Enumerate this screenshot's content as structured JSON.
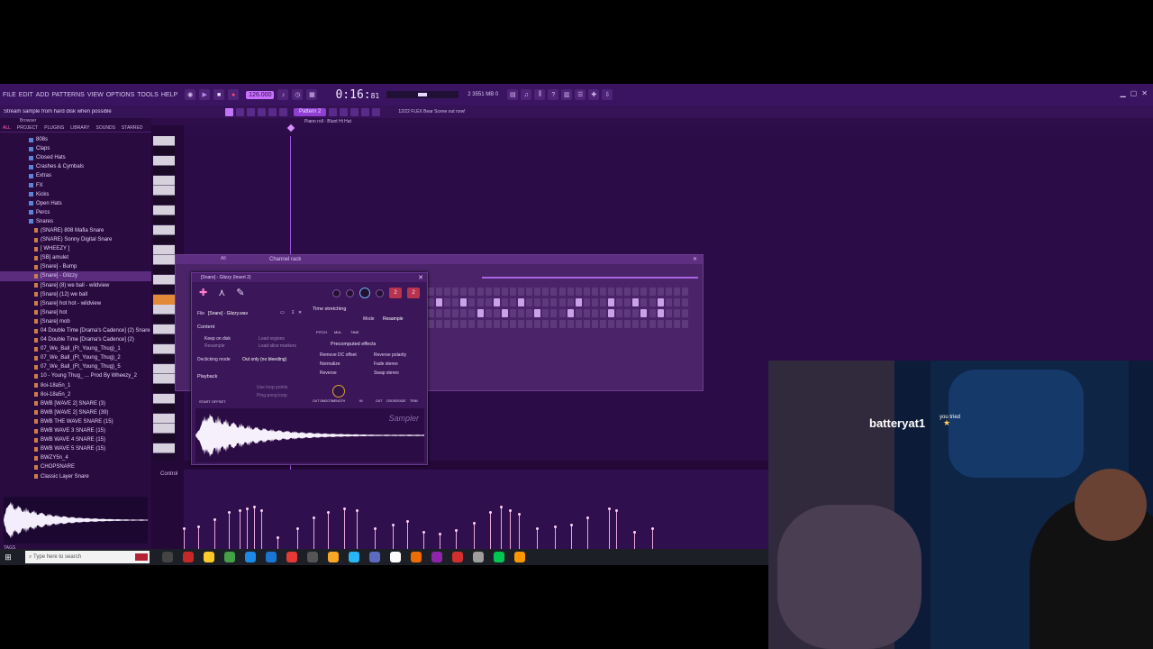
{
  "menu": {
    "items": [
      "FILE",
      "EDIT",
      "ADD",
      "PATTERNS",
      "VIEW",
      "OPTIONS",
      "TOOLS",
      "HELP"
    ],
    "tempo": "126.000",
    "time": "0:16:",
    "time_sub": "81",
    "cpu": "2  3551 MB\n  0"
  },
  "toolbar2": {
    "hint": "Stream sample from hard disk when possible",
    "pattern": "Pattern 2",
    "news": "12/22 FLEX Bear Scene\nout now!"
  },
  "browser": {
    "title": "Browser",
    "tabs": [
      "ALL",
      "PROJECT",
      "PLUGINS",
      "LIBRARY",
      "SOUNDS",
      "STARRED"
    ],
    "items": [
      {
        "label": "808s",
        "type": "folder"
      },
      {
        "label": "Claps",
        "type": "folder"
      },
      {
        "label": "Closed Hats",
        "type": "folder"
      },
      {
        "label": "Crashes & Cymbals",
        "type": "folder"
      },
      {
        "label": "Extras",
        "type": "folder"
      },
      {
        "label": "FX",
        "type": "folder"
      },
      {
        "label": "Kicks",
        "type": "folder"
      },
      {
        "label": "Open Hats",
        "type": "folder"
      },
      {
        "label": "Percs",
        "type": "folder"
      },
      {
        "label": "Snares",
        "type": "folder"
      },
      {
        "label": "(SNARE) 808 Mafia Snare",
        "type": "file"
      },
      {
        "label": "(SNARE) Sonny Digital Snare",
        "type": "file"
      },
      {
        "label": "[ WHEEZY ]",
        "type": "file"
      },
      {
        "label": "[SB] amulet",
        "type": "file"
      },
      {
        "label": "[Snare] - Bump",
        "type": "file"
      },
      {
        "label": "[Snare] - Glizzy",
        "type": "file",
        "selected": true
      },
      {
        "label": "[Snare] (8) we ball - wildview",
        "type": "file"
      },
      {
        "label": "[Snare] (12) we ball",
        "type": "file"
      },
      {
        "label": "[Snare] hot hot - wildview",
        "type": "file"
      },
      {
        "label": "[Snare] hot",
        "type": "file"
      },
      {
        "label": "[Snare] mob",
        "type": "file"
      },
      {
        "label": "04 Double Time [Drama's Cadence] (2) Snare",
        "type": "file"
      },
      {
        "label": "04 Double Time [Drama's Cadence] (2)",
        "type": "file"
      },
      {
        "label": "07_We_Ball_(Ft_Young_Thug)_1",
        "type": "file"
      },
      {
        "label": "07_We_Ball_(Ft_Young_Thug)_2",
        "type": "file"
      },
      {
        "label": "07_We_Ball_(Ft_Young_Thug)_5",
        "type": "file"
      },
      {
        "label": "10 - Young Thug_ ... Prod By Wheezy_2",
        "type": "file"
      },
      {
        "label": "8oi-18a5n_1",
        "type": "file"
      },
      {
        "label": "8oi-18a5n_2",
        "type": "file"
      },
      {
        "label": "BWB [WAVE 2] SNARE (3)",
        "type": "file"
      },
      {
        "label": "BWB [WAVE 2] SNARE (39)",
        "type": "file"
      },
      {
        "label": "BWB THE WAVE SNARE (15)",
        "type": "file"
      },
      {
        "label": "BWB WAVE 3 SNARE (15)",
        "type": "file"
      },
      {
        "label": "BWB WAVE 4 SNARE (15)",
        "type": "file"
      },
      {
        "label": "BWB WAVE 5 SNARE (15)",
        "type": "file"
      },
      {
        "label": "BWZY5n_4",
        "type": "file"
      },
      {
        "label": "CHOPSNARE",
        "type": "file"
      },
      {
        "label": "Classic Layer Snare",
        "type": "file"
      }
    ],
    "tags_label": "TAGS"
  },
  "pianoroll": {
    "title": "Piano roll - Blunt Hi Hat",
    "control_label": "Control",
    "velocities": [
      40,
      42,
      50,
      58,
      60,
      62,
      64,
      60,
      30,
      40,
      52,
      58,
      62,
      60,
      40,
      44,
      48,
      36,
      34,
      38,
      46,
      58,
      64,
      60,
      56,
      40,
      42,
      44,
      52,
      62,
      60,
      36,
      40
    ]
  },
  "channel_rack": {
    "title": "Channel rack",
    "filter": "All"
  },
  "sampler": {
    "title": "[Snare] - Glizzy (Insert 2)",
    "file_label": "File",
    "file_value": "[Snare] - Glizzy.wav",
    "content_label": "Content",
    "keep_on_disk": "Keep on disk",
    "resample": "Resample",
    "load_regions": "Load regions",
    "load_slice_markers": "Load slice markers",
    "declicking_label": "Declicking mode",
    "declicking_value": "Out only (no bleeding)",
    "playback_label": "Playback",
    "use_loop_points": "Use loop points",
    "ping_pong_loop": "Ping-pong loop",
    "start_offset": "START OFFSET",
    "time_stretching": "Time stretching",
    "mode_label": "Mode",
    "mode_value": "Resample",
    "pitch": "PITCH",
    "mul": "MUL",
    "time": "TIME",
    "precomputed": "Precomputed effects",
    "remove_dc": "Remove DC offset",
    "reverse_polarity": "Reverse polarity",
    "normalize": "Normalize",
    "fade_stereo": "Fade stereo",
    "reverse": "Reverse",
    "swap_stereo": "Swap stereo",
    "fx_labels": [
      "OUT SMOOTH",
      "LENGTH",
      "IN",
      "OUT",
      "CROSSFADE",
      "TRIM"
    ],
    "brand": "Sampler",
    "channel_num": "2",
    "tab_num": "2"
  },
  "webcam": {
    "name": "batteryat1",
    "tried": "you\ntried"
  },
  "taskbar": {
    "search_placeholder": "Type here to search"
  },
  "colors": {
    "app_bg": "#2c0a47",
    "accent": "#c274ff",
    "velocity": "#e9a7d8"
  }
}
